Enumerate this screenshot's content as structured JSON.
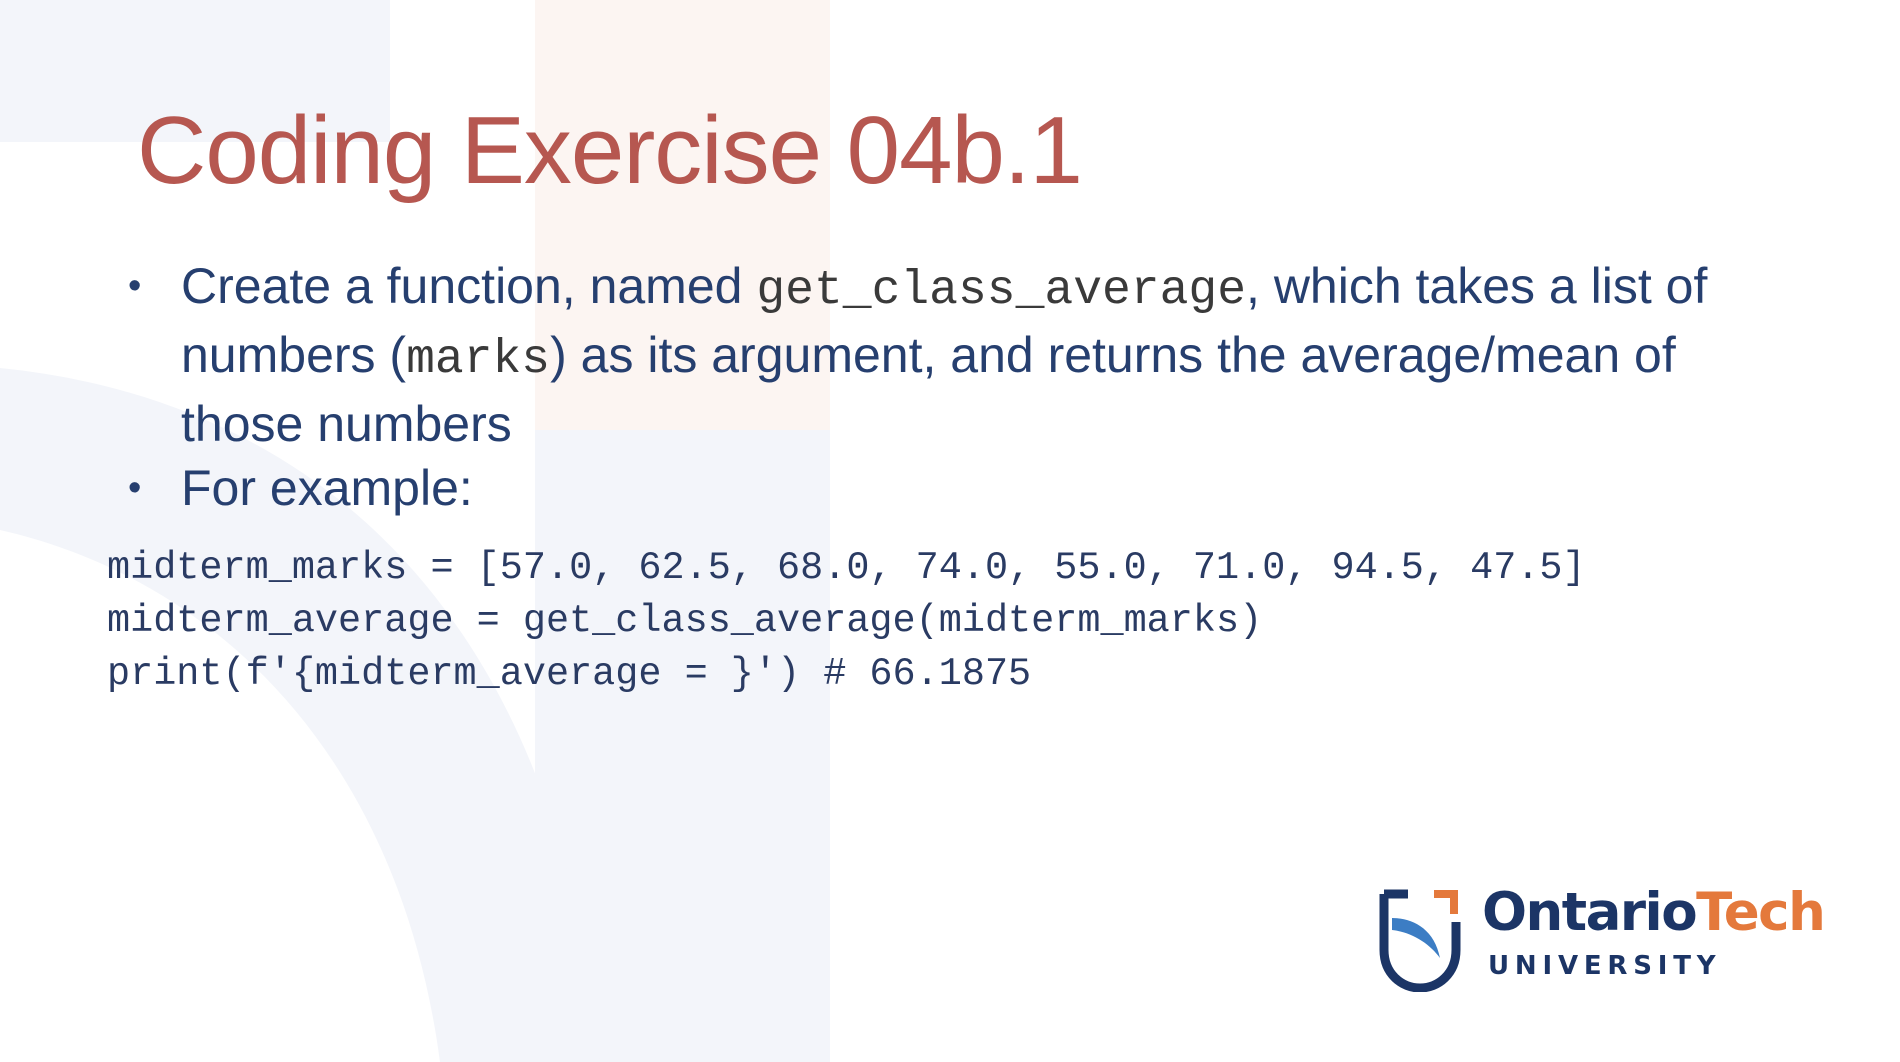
{
  "slide": {
    "title": "Coding Exercise 04b.1",
    "bullets": [
      {
        "marker": "•",
        "parts": [
          {
            "text": "Create a function, named ",
            "code": false
          },
          {
            "text": "get_class_average",
            "code": true
          },
          {
            "text": ", which takes a list of numbers (",
            "code": false
          },
          {
            "text": "marks",
            "code": true
          },
          {
            "text": ") as its argument, and returns the average/mean of those numbers",
            "code": false
          }
        ]
      },
      {
        "marker": "•",
        "parts": [
          {
            "text": "For example:",
            "code": false
          }
        ]
      }
    ],
    "code_lines": [
      "midterm_marks = [57.0, 62.5, 68.0, 74.0, 55.0, 71.0, 94.5, 47.5]",
      "midterm_average = get_class_average(midterm_marks)",
      "print(f'{midterm_average = }') # 66.1875"
    ]
  },
  "logo": {
    "name_part1": "Ontario",
    "name_part2": "Tech",
    "subtitle": "UNIVERSITY"
  },
  "colors": {
    "title": "#b65750",
    "body_text": "#263f6f",
    "code_text": "#2a3b63",
    "inline_code": "#3a3a3a",
    "logo_navy": "#1c3566",
    "logo_orange": "#e4793c",
    "logo_blue": "#3c7dc4",
    "bg_shape_light": "#f3f5fa",
    "bg_shape_warm": "#fcf5f2"
  },
  "icons": {
    "logo_mark": "ontario-tech-shield-icon"
  }
}
